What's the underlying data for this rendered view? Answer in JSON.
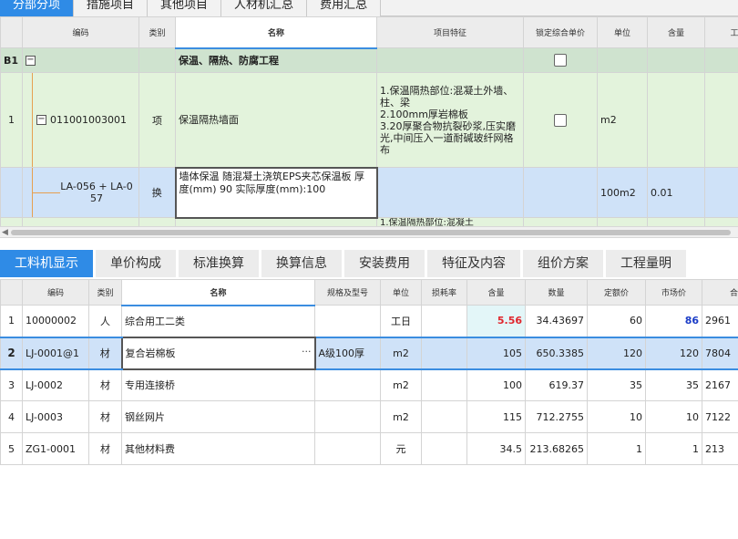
{
  "top_tabs": [
    {
      "label": "分部分项",
      "active": true
    },
    {
      "label": "措施项目",
      "active": false
    },
    {
      "label": "其他项目",
      "active": false
    },
    {
      "label": "人材机汇总",
      "active": false
    },
    {
      "label": "费用汇总",
      "active": false
    }
  ],
  "upper_grid": {
    "headers": {
      "code": "编码",
      "category": "类别",
      "name": "名称",
      "feature": "项目特征",
      "lock_price": "锁定综合单价",
      "unit": "单位",
      "quantity": "含量",
      "work": "工"
    },
    "section": {
      "num": "B1",
      "toggle": "−",
      "name": "保温、隔热、防腐工程"
    },
    "item": {
      "num": "1",
      "toggle": "−",
      "code": "011001003001",
      "category": "项",
      "name": "保温隔热墙面",
      "feature": "1.保温隔热部位:混凝土外墙、柱、梁\n2.100mm厚岩棉板\n3.20厚聚合物抗裂砂浆,压实磨光,中间压入一道耐碱玻纤网格布",
      "unit": "m2"
    },
    "sub": {
      "code": "LA-056 + LA-057",
      "category": "换",
      "name": "墙体保温 随混凝土浇筑EPS夹芯保温板 厚度(mm) 90 实际厚度(mm):100",
      "unit": "100m2",
      "quantity": "0.01"
    },
    "partial": {
      "feature": "1.保温隔热部位:混凝土"
    }
  },
  "lower_tabs": [
    {
      "label": "工料机显示",
      "active": true
    },
    {
      "label": "单价构成",
      "active": false
    },
    {
      "label": "标准换算",
      "active": false
    },
    {
      "label": "换算信息",
      "active": false
    },
    {
      "label": "安装费用",
      "active": false
    },
    {
      "label": "特征及内容",
      "active": false
    },
    {
      "label": "组价方案",
      "active": false
    },
    {
      "label": "工程量明",
      "active": false
    }
  ],
  "lower_grid": {
    "headers": {
      "code": "编码",
      "category": "类别",
      "name": "名称",
      "spec": "规格及型号",
      "unit": "单位",
      "loss": "损耗率",
      "content": "含量",
      "amount": "数量",
      "quota_price": "定额价",
      "market_price": "市场价",
      "total": "合"
    },
    "rows": [
      {
        "num": "1",
        "code": "10000002",
        "category": "人",
        "name": "综合用工二类",
        "spec": "",
        "unit": "工日",
        "loss": "",
        "content": "5.56",
        "amount": "34.43697",
        "quota_price": "60",
        "market_price": "86",
        "total": "2961"
      },
      {
        "num": "2",
        "code": "LJ-0001@1",
        "category": "材",
        "name": "复合岩棉板",
        "spec": "A级100厚",
        "unit": "m2",
        "loss": "",
        "content": "105",
        "amount": "650.3385",
        "quota_price": "120",
        "market_price": "120",
        "total": "7804"
      },
      {
        "num": "3",
        "code": "LJ-0002",
        "category": "材",
        "name": "专用连接桥",
        "spec": "",
        "unit": "m2",
        "loss": "",
        "content": "100",
        "amount": "619.37",
        "quota_price": "35",
        "market_price": "35",
        "total": "2167"
      },
      {
        "num": "4",
        "code": "LJ-0003",
        "category": "材",
        "name": "钢丝网片",
        "spec": "",
        "unit": "m2",
        "loss": "",
        "content": "115",
        "amount": "712.2755",
        "quota_price": "10",
        "market_price": "10",
        "total": "7122"
      },
      {
        "num": "5",
        "code": "ZG1-0001",
        "category": "材",
        "name": "其他材料费",
        "spec": "",
        "unit": "元",
        "loss": "",
        "content": "34.5",
        "amount": "213.68265",
        "quota_price": "1",
        "market_price": "1",
        "total": "213"
      }
    ]
  },
  "colors": {
    "accent": "#2f8be6",
    "header_bg": "#ececec",
    "row_green": "#e3f3dc",
    "section_green": "#cfe3cf",
    "selected_blue": "#cfe2f8",
    "red_value": "#e0262d",
    "blue_value": "#1a3cc7"
  }
}
